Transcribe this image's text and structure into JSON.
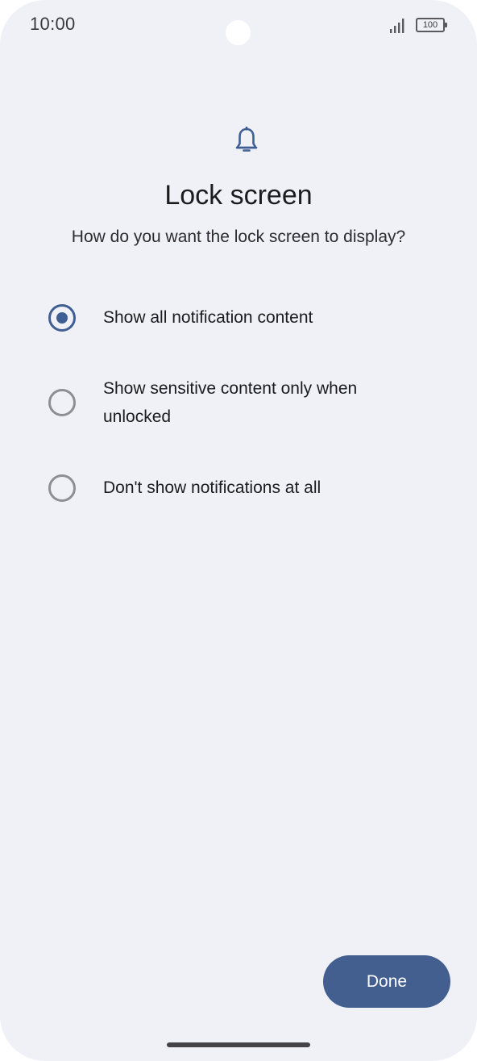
{
  "status_bar": {
    "time": "10:00",
    "battery_level": "100"
  },
  "header": {
    "icon": "bell-icon",
    "title": "Lock screen",
    "subtitle": "How do you want the lock screen to display?"
  },
  "options": [
    {
      "label": "Show all notification content",
      "selected": true
    },
    {
      "label": "Show sensitive content only when unlocked",
      "selected": false
    },
    {
      "label": "Don't show notifications at all",
      "selected": false
    }
  ],
  "footer": {
    "done_label": "Done"
  },
  "colors": {
    "accent": "#435f90",
    "background": "#f0f0f7",
    "radio_unselected": "#8e8e93"
  }
}
